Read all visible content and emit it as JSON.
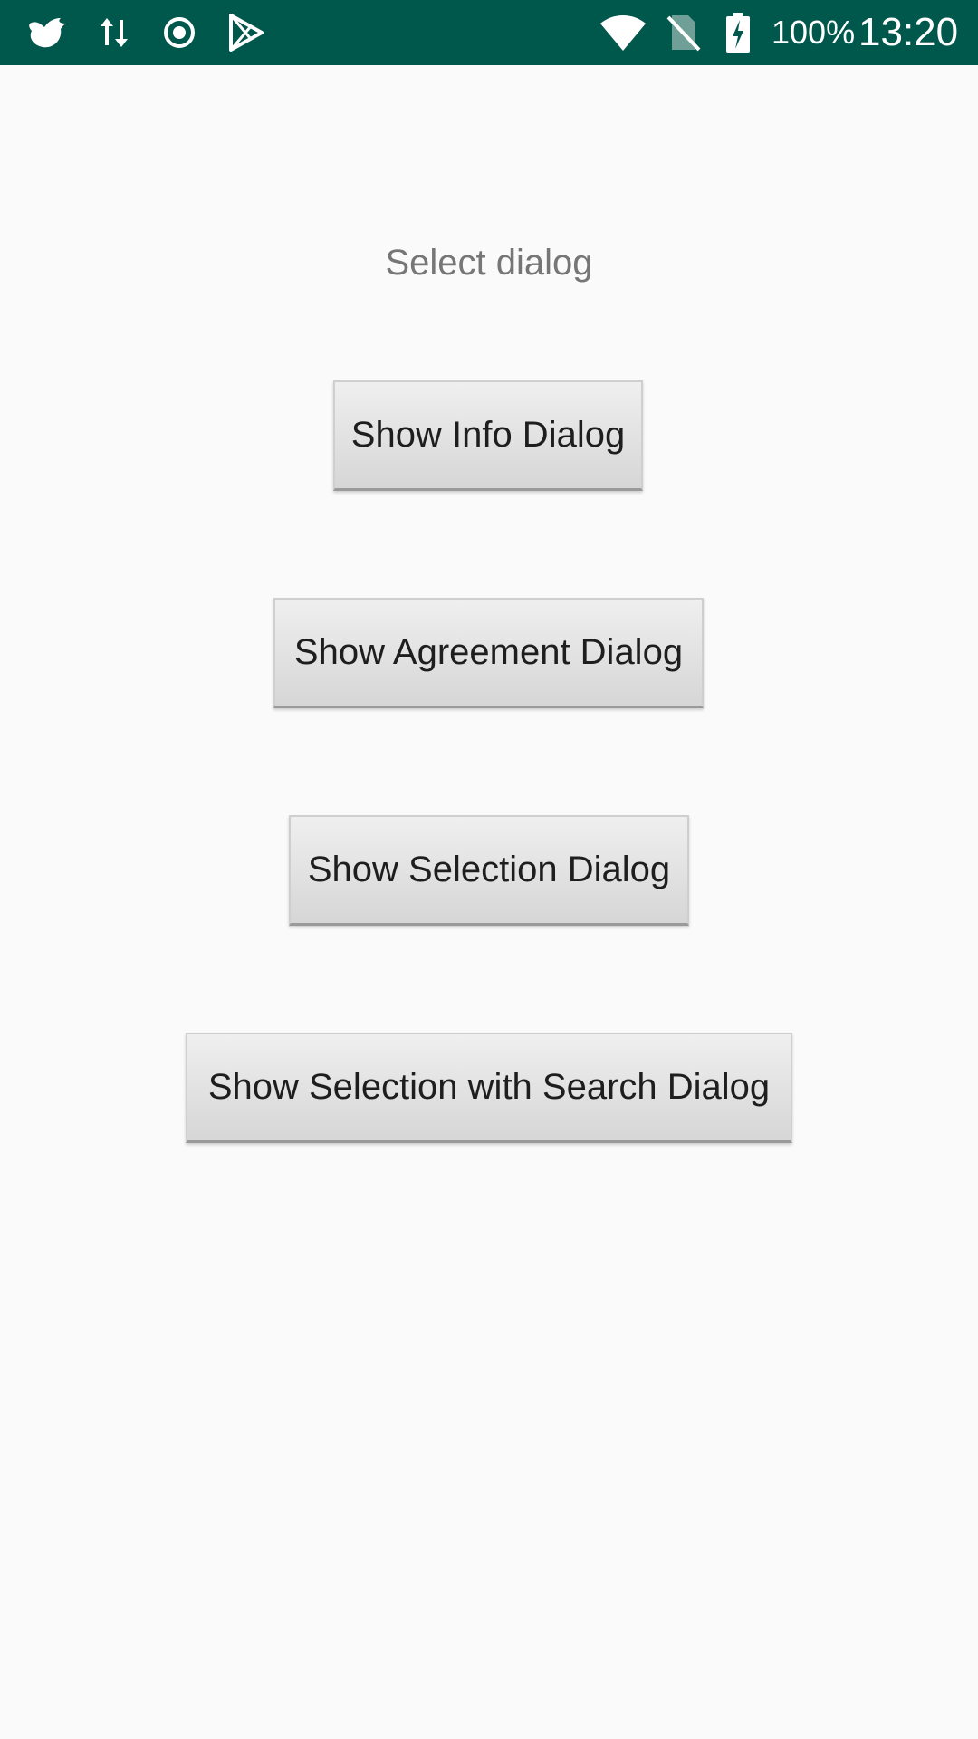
{
  "status_bar": {
    "background": "#00574b",
    "left_icons": [
      "bird-icon",
      "data-transfer-icon",
      "record-icon",
      "play-store-icon"
    ],
    "right_icons": [
      "wifi-icon",
      "no-sim-icon",
      "battery-charging-icon"
    ],
    "battery_percent": "100%",
    "time": "13:20"
  },
  "main": {
    "title": "Select dialog",
    "buttons": [
      {
        "label": "Show Info Dialog"
      },
      {
        "label": "Show Agreement Dialog"
      },
      {
        "label": "Show Selection Dialog"
      },
      {
        "label": "Show Selection with Search Dialog"
      }
    ]
  }
}
